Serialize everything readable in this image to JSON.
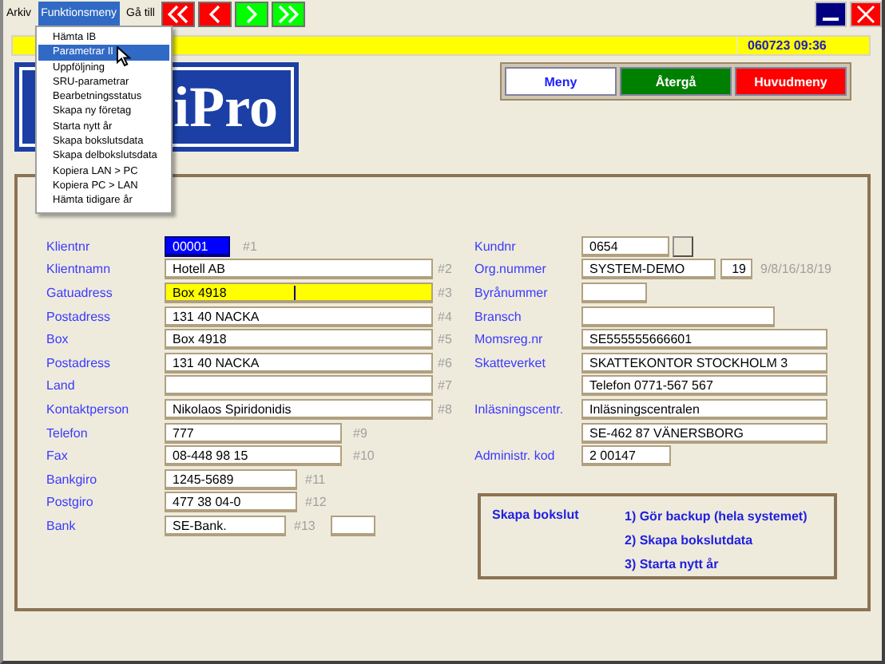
{
  "menubar": [
    {
      "label": "Arkiv",
      "selected": false
    },
    {
      "label": "Funktionsmeny",
      "selected": true
    },
    {
      "label": "Gå till",
      "selected": false
    }
  ],
  "nav_buttons": [
    {
      "kind": "first",
      "color": "#ff0000"
    },
    {
      "kind": "prev",
      "color": "#ff0000"
    },
    {
      "kind": "next",
      "color": "#00ff00"
    },
    {
      "kind": "last",
      "color": "#00ff00"
    }
  ],
  "dropdown": {
    "items": [
      {
        "label": "Hämta IB",
        "selected": false
      },
      {
        "label": "Parametrar II",
        "selected": true
      },
      {
        "label": "Uppföljning",
        "selected": false
      },
      {
        "label": "SRU-parametrar",
        "selected": false
      },
      {
        "label": "Bearbetningsstatus",
        "selected": false
      },
      {
        "label": "Skapa ny företag",
        "selected": false
      },
      {
        "label": "Starta nytt år",
        "selected": false
      },
      {
        "label": "Skapa bokslutsdata",
        "selected": false
      },
      {
        "label": "Skapa delbokslutsdata",
        "selected": false
      },
      {
        "label": "Kopiera LAN > PC",
        "selected": false
      },
      {
        "label": "Kopiera PC  > LAN",
        "selected": false
      },
      {
        "label": "Hämta tidigare år",
        "selected": false
      }
    ]
  },
  "datetime": "060723 09:36",
  "logo": {
    "text": "iPro"
  },
  "action_buttons": [
    {
      "label": "Meny",
      "color": "#ffffff"
    },
    {
      "label": "Återgå",
      "color": "#008000"
    },
    {
      "label": "Huvudmeny",
      "color": "#ff0000"
    }
  ],
  "left_fields": [
    {
      "label": "Klientnr",
      "value": "00001",
      "tag": "#1",
      "kind": "id",
      "focused": false
    },
    {
      "label": "Klientnamn",
      "value": "Hotell AB",
      "tag": "#2",
      "kind": "wide",
      "focused": false
    },
    {
      "label": "Gatuadress",
      "value": "Box 4918",
      "tag": "#3",
      "kind": "wide",
      "focused": true
    },
    {
      "label": "Postadress",
      "value": "131 40 NACKA",
      "tag": "#4",
      "kind": "wide",
      "focused": false
    },
    {
      "label": "Box",
      "value": "Box 4918",
      "tag": "#5",
      "kind": "wide",
      "focused": false
    },
    {
      "label": "Postadress",
      "value": "131 40 NACKA",
      "tag": "#6",
      "kind": "wide",
      "focused": false
    },
    {
      "label": "Land",
      "tag": "#7",
      "kind": "wide",
      "focused": false
    },
    {
      "label": "Kontaktperson",
      "value": "Nikolaos Spiridonidis",
      "tag": "#8",
      "kind": "wide",
      "focused": false
    },
    {
      "label": "Telefon",
      "value": "777",
      "tag": "#9",
      "kind": "medium",
      "focused": false
    },
    {
      "label": "Fax",
      "value": "08-448 98 15",
      "tag": "#10",
      "kind": "medium",
      "focused": false
    },
    {
      "label": "Bankgiro",
      "value": "1245-5689",
      "tag": "#11",
      "kind": "short",
      "focused": false
    },
    {
      "label": "Postgiro",
      "value": "477 38 04-0",
      "tag": "#12",
      "kind": "short",
      "focused": false
    },
    {
      "label": "Bank",
      "value": "SE-Bank.",
      "tag": "#13",
      "kind": "bank",
      "focused": false
    }
  ],
  "right_fields": [
    {
      "label": "Kundnr",
      "value": "0654",
      "kind": "lookup"
    },
    {
      "label": "Org.nummer",
      "value": "SYSTEM-DEMO",
      "extra_value": "19",
      "hint": "9/8/16/18/19",
      "kind": "org"
    },
    {
      "label": "Byrånummer",
      "kind": "tiny"
    },
    {
      "label": "Bransch",
      "kind": "medium"
    },
    {
      "label": "Momsreg.nr",
      "value": "SE555555666601",
      "kind": "full"
    },
    {
      "label": "Skatteverket",
      "value": "SKATTEKONTOR STOCKHOLM 3",
      "kind": "full"
    },
    {
      "value": "Telefon 0771-567 567",
      "kind": "full"
    },
    {
      "label": "Inläsningscentr.",
      "value": "Inläsningscentralen",
      "kind": "full"
    },
    {
      "value": "SE-462 87 VÄNERSBORG",
      "kind": "full"
    },
    {
      "label": "Administr. kod",
      "value": "2 00147",
      "kind": "small"
    }
  ],
  "closing_box": {
    "title": "Skapa bokslut",
    "steps": [
      "1) Gör backup (hela systemet)",
      "2) Skapa bokslutdata",
      "3) Starta nytt år"
    ]
  }
}
